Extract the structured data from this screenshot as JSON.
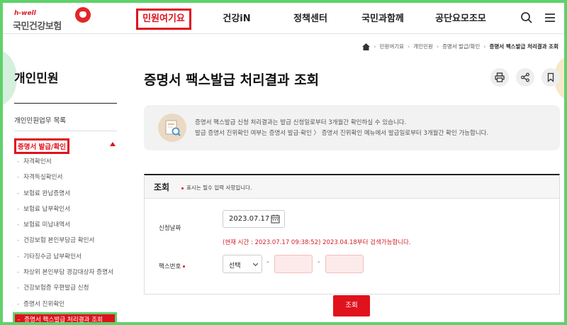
{
  "header": {
    "logo_small": "h-well",
    "logo_text": "국민건강보험",
    "nav": [
      "민원여기요",
      "건강iN",
      "정책센터",
      "국민과함께",
      "공단요모조모"
    ],
    "icons": [
      "search-icon",
      "menu-icon"
    ]
  },
  "breadcrumb": [
    "민원여기요",
    "개인민원",
    "증명서 발급/확인",
    "증명서 팩스발급 처리결과 조회"
  ],
  "sidebar": {
    "title": "개인민원",
    "section": "개인민원업무 목록",
    "category": "증명서 발급/확인",
    "items": [
      "자격확인서",
      "자격득실확인서",
      "보험료 완납증명서",
      "보험료 납부확인서",
      "보험료 미납내역서",
      "건강보험 본인부담금 확인서",
      "기타징수금 납부확인서",
      "차상위 본인부담 경감대상자 증명서",
      "건강보험증 우편발급 신청",
      "증명서 진위확인",
      "증명서 팩스발급 처리결과 조회"
    ]
  },
  "main": {
    "title": "증명서 팩스발급 처리결과 조회",
    "tools": [
      "print-icon",
      "share-icon",
      "bookmark-icon"
    ],
    "info_line1": "증명서 팩스발급 신청 처리결과는 발급 신청일로부터 3개월간 확인하실 수 있습니다.",
    "info_line2": "발급 증명서 진위확인 여부는 증명서 발급·확인 〉 증명서 진위확인 메뉴에서 발급일로부터 3개월간 확인 가능합니다.",
    "search_title": "조회",
    "required_note": "표시는 필수 입력 사항입니다.",
    "date_label": "신청날짜",
    "date_value": "2023.07.17",
    "notice": "(현재 시간 : 2023.07.17 09:38:52) 2023.04.18부터 검색가능합니다.",
    "fax_label": "팩스번호",
    "fax_select": "선택",
    "dash": "-",
    "submit": "조회"
  },
  "colors": {
    "accent": "#e0121c",
    "highlight": "#5fd16a"
  }
}
